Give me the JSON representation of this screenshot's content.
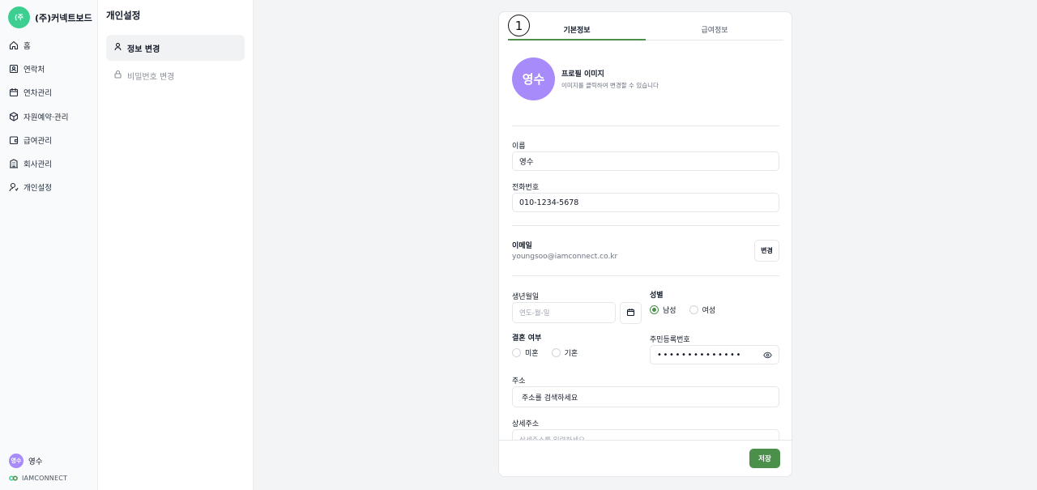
{
  "brand": {
    "logo_text": "(주",
    "name": "(주)커넥트보드"
  },
  "nav": {
    "items": [
      {
        "label": "홈",
        "icon": "home-icon"
      },
      {
        "label": "연락처",
        "icon": "contact-icon"
      },
      {
        "label": "연차관리",
        "icon": "calendar-icon"
      },
      {
        "label": "자원예약·관리",
        "icon": "box-icon"
      },
      {
        "label": "급여관리",
        "icon": "wallet-icon"
      },
      {
        "label": "회사관리",
        "icon": "building-icon"
      },
      {
        "label": "개인설정",
        "icon": "user-settings-icon"
      }
    ],
    "user": {
      "avatar": "영수",
      "name": "영수"
    },
    "company": "IAMCONNECT"
  },
  "settings_menu": {
    "title": "개인설정",
    "items": [
      {
        "label": "정보 변경",
        "icon": "user-icon",
        "active": true
      },
      {
        "label": "비밀번호 변경",
        "icon": "lock-icon",
        "active": false
      }
    ]
  },
  "tabs": {
    "annotation": "1",
    "basic": "기본정보",
    "salary": "급여정보"
  },
  "profile": {
    "avatar": "영수",
    "title": "프로필 이미지",
    "hint": "이미지를 클릭하여 변경할 수 있습니다"
  },
  "form": {
    "name_label": "이름",
    "name_value": "영수",
    "phone_label": "전화번호",
    "phone_value": "010-1234-5678",
    "email_label": "이메일",
    "email_value": "youngsoo@iamconnect.co.kr",
    "email_change": "변경",
    "birth_label": "생년월일",
    "birth_placeholder": "연도-월-일",
    "gender_label": "성별",
    "gender_male": "남성",
    "gender_female": "여성",
    "marital_label": "결혼 여부",
    "marital_single": "미혼",
    "marital_married": "기혼",
    "rrn_label": "주민등록번호",
    "rrn_value": "••••••••••••••",
    "address_label": "주소",
    "address_value": "주소를 검색하세요",
    "detail_label": "상세주소",
    "detail_placeholder": "상세주소를 입력하세요"
  },
  "footer": {
    "save": "저장"
  },
  "colors": {
    "accent": "#4a8f4a",
    "brand": "#3ccf91",
    "avatar": "#a78bfa"
  }
}
